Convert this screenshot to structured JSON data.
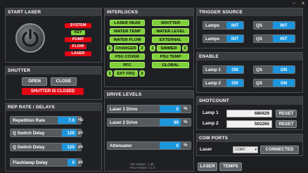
{
  "window": {
    "minimize": "–",
    "close": "✕"
  },
  "start_laser": {
    "title": "START LASER",
    "status": [
      "SYSTEM",
      "KEY",
      "PUMP",
      "FLOW",
      "LASER"
    ]
  },
  "shutter": {
    "title": "SHUTTER",
    "open": "OPEN",
    "close": "CLOSE",
    "state": "SHUTTER IS CLOSED"
  },
  "rep_rate": {
    "title": "REP RATE / DELAYS",
    "rows": [
      {
        "label": "Repetition Rate",
        "value": "7.0",
        "unit": "Hz"
      },
      {
        "label": "Q Switch Delay",
        "value": "120",
        "unit": "µs"
      },
      {
        "label": "Q Switch Delay",
        "value": "125",
        "unit": "µs"
      },
      {
        "label": "Flashlamp Delay",
        "value": "0",
        "unit": "µs"
      }
    ]
  },
  "interlocks": {
    "title": "INTERLOCKS",
    "items": [
      "LASER HEAD",
      "SHUTTER",
      "WATER TEMP",
      "WATER LEVEL",
      "WATER FLOW",
      "EXTERNAL",
      "CHARGER",
      "SIMMER",
      "PSU COVER",
      "PSU TEMP",
      "PFC",
      "GLOBAL",
      "EXT FRQ"
    ],
    "nums": [
      "1",
      "2",
      "1",
      "2",
      "1",
      "2"
    ]
  },
  "drive_levels": {
    "title": "DRIVE LEVELS",
    "rows": [
      {
        "label": "Laser 1 Drive",
        "value": "0",
        "unit": "%"
      },
      {
        "label": "Laser 2 Drive",
        "value": "90",
        "unit": "%"
      },
      {
        "label": "Attenuator",
        "value": "0",
        "unit": "%"
      }
    ],
    "sw_version": "SW Version : 1.38",
    "psu_version": "PSU Version: 2.1.0"
  },
  "trigger": {
    "title": "TRIGGER SOURCE",
    "rows": [
      {
        "a": "Lamps",
        "a_val": "INT",
        "b": "QS",
        "b_val": "INT"
      },
      {
        "a": "Lamps",
        "a_val": "INT",
        "b": "QS",
        "b_val": "INT"
      }
    ]
  },
  "enable": {
    "title": "ENABLE",
    "rows": [
      {
        "a": "Lamp 1",
        "a_val": "ON",
        "b": "QS",
        "b_val": "ON"
      },
      {
        "a": "Lamp 2",
        "a_val": "ON",
        "b": "QS",
        "b_val": "ON"
      }
    ]
  },
  "shotcount": {
    "title": "SHOTCOUNT",
    "rows": [
      {
        "label": "Lamp 1",
        "value": "680429",
        "reset": "RESET"
      },
      {
        "label": "Lamp 2",
        "value": "502265",
        "reset": "RESET"
      }
    ]
  },
  "com": {
    "title": "COM PORTS",
    "label": "Laser",
    "port": "COM7",
    "connect": "CONNECTED"
  },
  "bottom": {
    "laser": "LASER",
    "temps": "TEMPS"
  }
}
